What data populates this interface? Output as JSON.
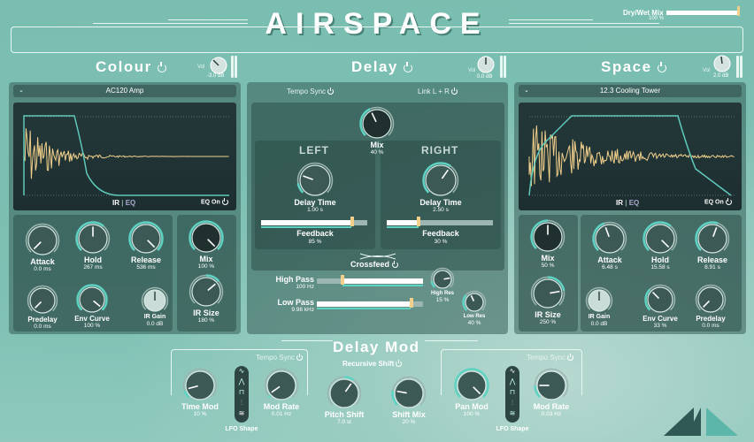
{
  "app": {
    "title": "AIRSPACE"
  },
  "dry_wet": {
    "label": "Dry/Wet Mix",
    "value": "100 %",
    "fraction": 1.0
  },
  "colour": {
    "title": "Colour",
    "vol": {
      "label": "Vol",
      "value": "-3.0 dB"
    },
    "preset": "AC120 Amp",
    "display": {
      "tab_ir": "IR",
      "tab_eq": "EQ",
      "eq_toggle": "EQ On"
    },
    "knobs": [
      {
        "name": "Attack",
        "value": "0.0 ms"
      },
      {
        "name": "Hold",
        "value": "267 ms"
      },
      {
        "name": "Release",
        "value": "536 ms"
      },
      {
        "name": "Mix",
        "value": "100 %"
      },
      {
        "name": "Predelay",
        "value": "0.0 ms"
      },
      {
        "name": "Env Curve",
        "value": "100 %"
      },
      {
        "name": "IR Gain",
        "value": "0.0 dB"
      },
      {
        "name": "IR Size",
        "value": "180 %"
      }
    ]
  },
  "delay": {
    "title": "Delay",
    "vol": {
      "label": "Vol",
      "value": "0.0 dB"
    },
    "tempo_sync": "Tempo Sync",
    "link": "Link L + R",
    "mix": {
      "name": "Mix",
      "value": "40 %"
    },
    "left": {
      "title": "LEFT",
      "time_label": "Delay Time",
      "time_value": "1.00 s",
      "fb_label": "Feedback",
      "fb_value": "85 %",
      "fb_fraction": 0.85
    },
    "right": {
      "title": "RIGHT",
      "time_label": "Delay Time",
      "time_value": "2.50 s",
      "fb_label": "Feedback",
      "fb_value": "30 %",
      "fb_fraction": 0.3
    },
    "crossfeed": "Crossfeed",
    "high_pass": {
      "label": "High Pass",
      "value": "100 Hz",
      "res_label": "High Res",
      "res_value": "15 %"
    },
    "low_pass": {
      "label": "Low Pass",
      "value": "9.98 kHz",
      "res_label": "Low Res",
      "res_value": "40 %"
    }
  },
  "space": {
    "title": "Space",
    "vol": {
      "label": "Vol",
      "value": "2.0 dB"
    },
    "preset": "12.3 Cooling Tower",
    "display": {
      "tab_ir": "IR",
      "tab_eq": "EQ",
      "eq_toggle": "EQ On"
    },
    "knobs": [
      {
        "name": "Mix",
        "value": "50 %"
      },
      {
        "name": "Attack",
        "value": "6.48 s"
      },
      {
        "name": "Hold",
        "value": "15.58 s"
      },
      {
        "name": "Release",
        "value": "8.91 s"
      },
      {
        "name": "IR Size",
        "value": "250 %"
      },
      {
        "name": "IR Gain",
        "value": "0.0 dB"
      },
      {
        "name": "Env Curve",
        "value": "33 %"
      },
      {
        "name": "Predelay",
        "value": "0.0 ms"
      }
    ]
  },
  "delay_mod": {
    "title": "Delay Mod",
    "tempo_sync": "Tempo Sync",
    "recursive_shift": "Recursive Shift",
    "lfo_label": "LFO Shape",
    "knobs": [
      {
        "name": "Time Mod",
        "value": "10 %"
      },
      {
        "name": "Mod Rate",
        "value": "0.01 Hz"
      },
      {
        "name": "Pitch Shift",
        "value": "7.0 st"
      },
      {
        "name": "Shift Mix",
        "value": "20 %"
      },
      {
        "name": "Pan Mod",
        "value": "100 %"
      },
      {
        "name": "Mod Rate",
        "value": "0.03 Hz"
      }
    ],
    "lfo_shapes": [
      "sine",
      "triangle",
      "square",
      "random-step",
      "noise"
    ]
  },
  "colors": {
    "accent": "#5ed3c4",
    "waveform": "#f2d08b",
    "panel": "#375f58"
  }
}
